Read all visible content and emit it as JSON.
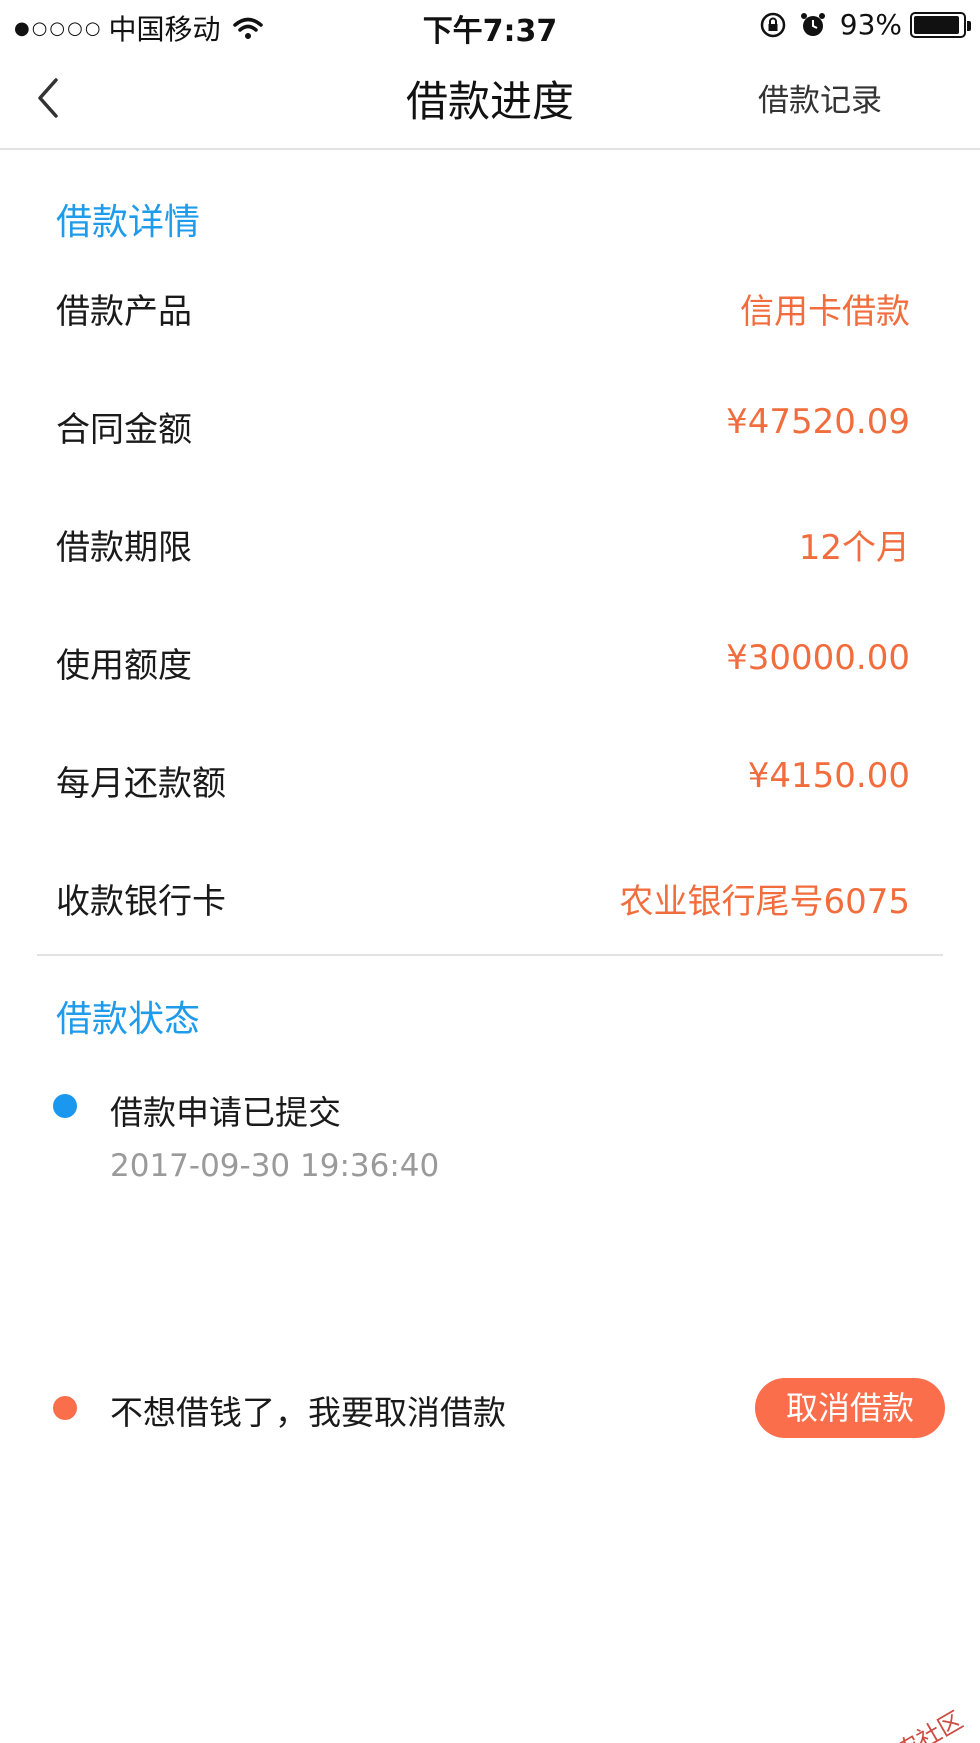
{
  "status_bar": {
    "signal": "●○○○○",
    "carrier": "中国移动",
    "time": "下午7:37",
    "battery": "93%",
    "battery_level": 0.93
  },
  "nav": {
    "title": "借款进度",
    "right_link": "借款记录"
  },
  "details": {
    "section_title": "借款详情",
    "rows": [
      {
        "label": "借款产品",
        "value": "信用卡借款"
      },
      {
        "label": "合同金额",
        "value": "¥47520.09"
      },
      {
        "label": "借款期限",
        "value": "12个月"
      },
      {
        "label": "使用额度",
        "value": "¥30000.00"
      },
      {
        "label": "每月还款额",
        "value": "¥4150.00"
      },
      {
        "label": "收款银行卡",
        "value": "农业银行尾号6075"
      }
    ]
  },
  "status": {
    "section_title": "借款状态",
    "submitted_text": "借款申请已提交",
    "submitted_time": "2017-09-30 19:36:40",
    "cancel_prompt": "不想借钱了，我要取消借款",
    "cancel_button": "取消借款"
  },
  "watermark": "卡农社区",
  "colors": {
    "accent_blue": "#1e9bea",
    "accent_orange": "#f26d3d",
    "button_orange": "#fb6e4b"
  }
}
